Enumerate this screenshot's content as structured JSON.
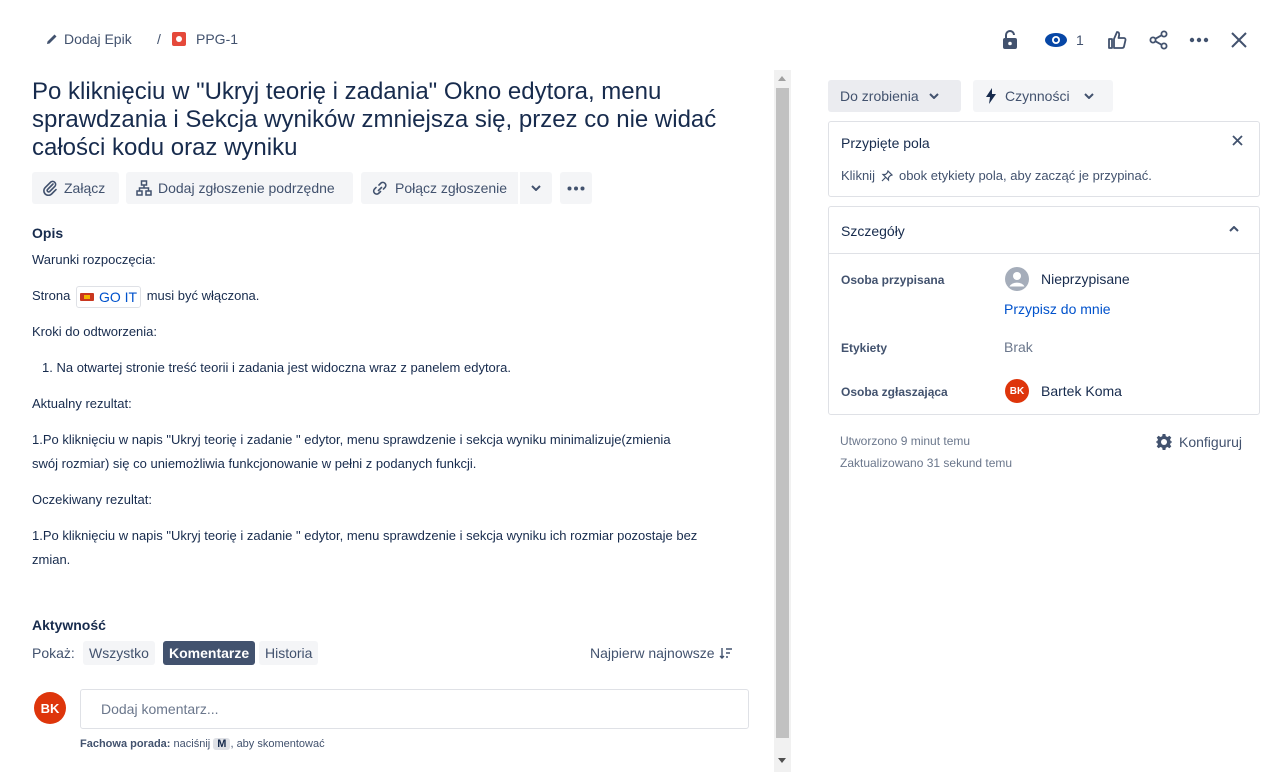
{
  "header": {
    "epic_label": "Dodaj Epik",
    "separator": "/",
    "issue_key": "PPG-1",
    "watch_count": "1",
    "issue_color": "#e5493a"
  },
  "title": "Po kliknięciu w \"Ukryj teorię i zadania\" Okno edytora, menu sprawdzania i Sekcja wyników zmniejsza się, przez co nie widać całości kodu oraz wyniku",
  "toolbar": {
    "attach": "Załącz",
    "add_child": "Dodaj zgłoszenie podrzędne",
    "link_issue": "Połącz zgłoszenie"
  },
  "description": {
    "label": "Opis",
    "preconditions": "Warunki rozpoczęcia:",
    "page_prefix": "Strona",
    "page_link": "GO IT",
    "page_suffix": "musi być włączona.",
    "steps_heading": "Kroki do odtworzenia:",
    "step_1": "Na otwartej stronie treść teorii i zadania jest widoczna wraz z panelem edytora.",
    "actual_heading": "Aktualny rezultat:",
    "actual_line1": "1.Po kliknięciu w napis \"Ukryj teorię i zadanie \" edytor, menu sprawdzenie i sekcja wyniku minimalizuje(zmienia",
    "actual_line2": "swój rozmiar) się co uniemożliwia funkcjonowanie w pełni z podanych funkcji.",
    "expected_heading": "Oczekiwany rezultat:",
    "expected_line1": "1.Po kliknięciu w napis \"Ukryj teorię i zadanie \" edytor, menu sprawdzenie i sekcja wyniku ich rozmiar pozostaje bez",
    "expected_line2": "zmian."
  },
  "activity": {
    "label": "Aktywność",
    "show_label": "Pokaż:",
    "filters": [
      "Wszystko",
      "Komentarze",
      "Historia"
    ],
    "sort": "Najpierw najnowsze",
    "avatar_initials": "BK",
    "comment_placeholder": "Dodaj komentarz...",
    "tip_bold": "Fachowa porada:",
    "tip_text": "naciśnij",
    "tip_key": "M",
    "tip_suffix": ", aby skomentować"
  },
  "right": {
    "status": "Do zrobienia",
    "actions": "Czynności",
    "pinned": {
      "title": "Przypięte pola",
      "hint_prefix": "Kliknij",
      "hint_suffix": "obok etykiety pola, aby zacząć je przypinać."
    },
    "details": {
      "title": "Szczegóły",
      "assignee_label": "Osoba przypisana",
      "assignee_value": "Nieprzypisane",
      "assign_me": "Przypisz do mnie",
      "labels_label": "Etykiety",
      "labels_value": "Brak",
      "reporter_label": "Osoba zgłaszająca",
      "reporter_initials": "BK",
      "reporter_name": "Bartek Koma"
    },
    "created": "Utworzono 9 minut temu",
    "updated": "Zaktualizowano 31 sekund temu",
    "configure": "Konfiguruj"
  }
}
